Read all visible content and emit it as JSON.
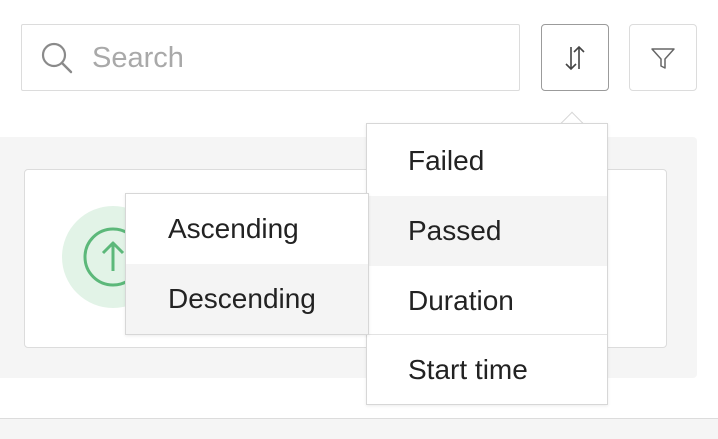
{
  "search": {
    "placeholder": "Search",
    "value": "",
    "icon": "search-icon"
  },
  "toolbar": {
    "sort_icon": "sort-arrows-icon",
    "filter_icon": "filter-funnel-icon"
  },
  "sort_menu": {
    "items": [
      {
        "label": "Failed"
      },
      {
        "label": "Passed"
      },
      {
        "label": "Duration"
      },
      {
        "label": "Start time"
      }
    ],
    "highlighted": "Passed"
  },
  "order_menu": {
    "items": [
      {
        "label": "Ascending"
      },
      {
        "label": "Descending"
      }
    ],
    "highlighted": "Descending"
  },
  "card": {
    "status_icon": "arrow-up-circle-icon"
  },
  "colors": {
    "status_green": "#5cb87a",
    "status_green_bg": "#e2f3e7",
    "border": "#dcdcdc",
    "hover": "#f4f4f4",
    "panel": "#f5f5f5"
  }
}
